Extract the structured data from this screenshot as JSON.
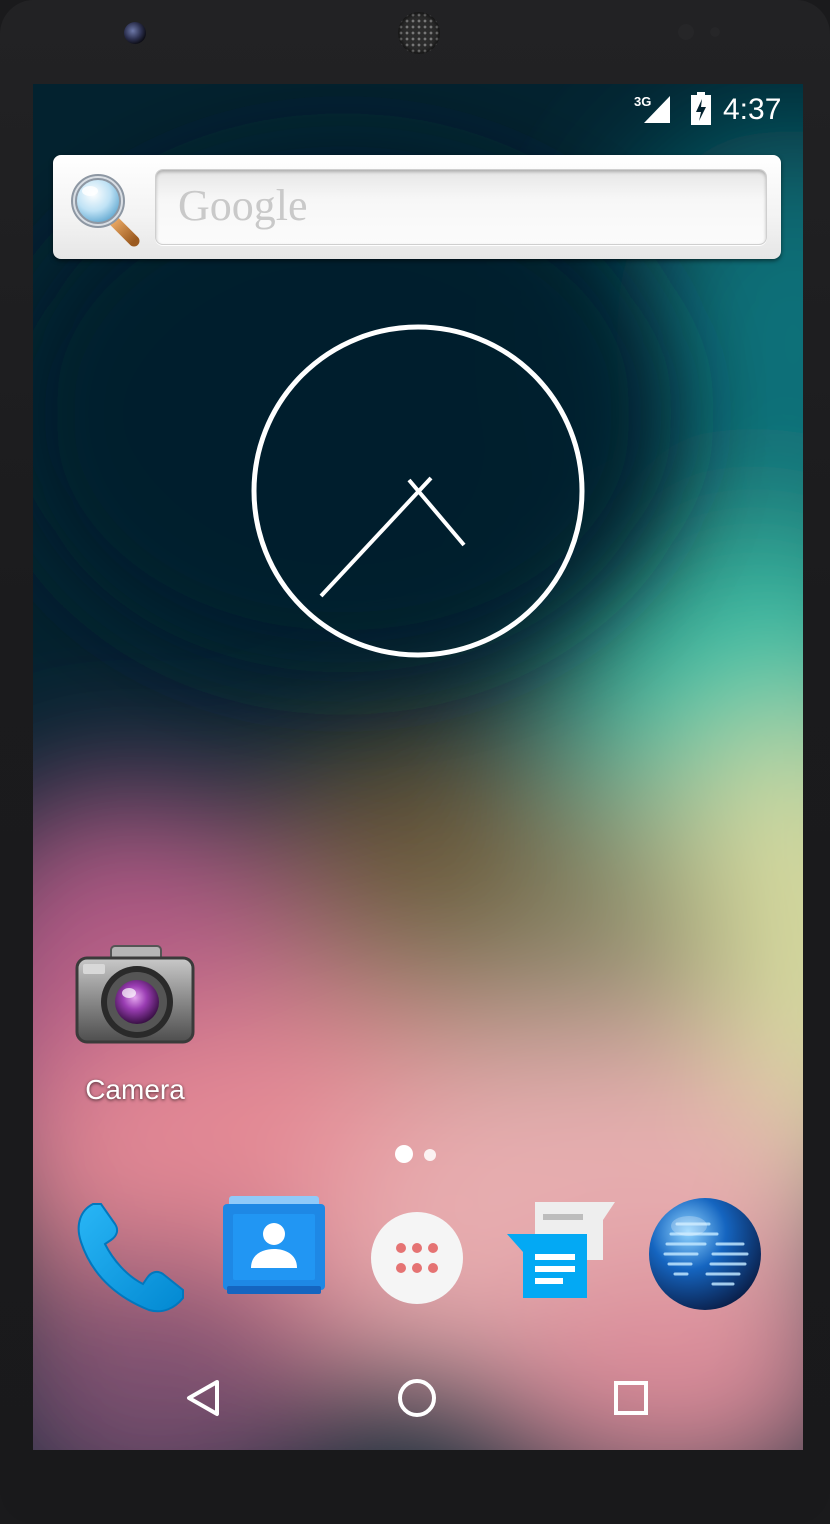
{
  "status_bar": {
    "network_type": "3G",
    "time": "4:37",
    "icons": [
      "signal-icon",
      "battery-charging-icon"
    ]
  },
  "search_widget": {
    "placeholder": "Google",
    "icon": "magnifier-icon"
  },
  "clock_widget": {
    "type": "analog",
    "time": "4:37"
  },
  "home_shortcuts": [
    {
      "label": "Camera",
      "icon": "camera-icon"
    }
  ],
  "page_indicator": {
    "pages": 2,
    "current": 1
  },
  "dock": [
    {
      "name": "phone",
      "icon": "phone-icon"
    },
    {
      "name": "contacts",
      "icon": "contacts-icon"
    },
    {
      "name": "all-apps",
      "icon": "app-drawer-icon"
    },
    {
      "name": "messaging",
      "icon": "messages-icon"
    },
    {
      "name": "browser",
      "icon": "globe-icon"
    }
  ],
  "nav_bar": {
    "buttons": [
      "back-icon",
      "home-icon",
      "recent-apps-icon"
    ]
  },
  "colors": {
    "screen_bg": "#032230",
    "dock_blue": "#03a9f4",
    "contacts_blue": "#1e88e5",
    "white": "#ffffff"
  }
}
